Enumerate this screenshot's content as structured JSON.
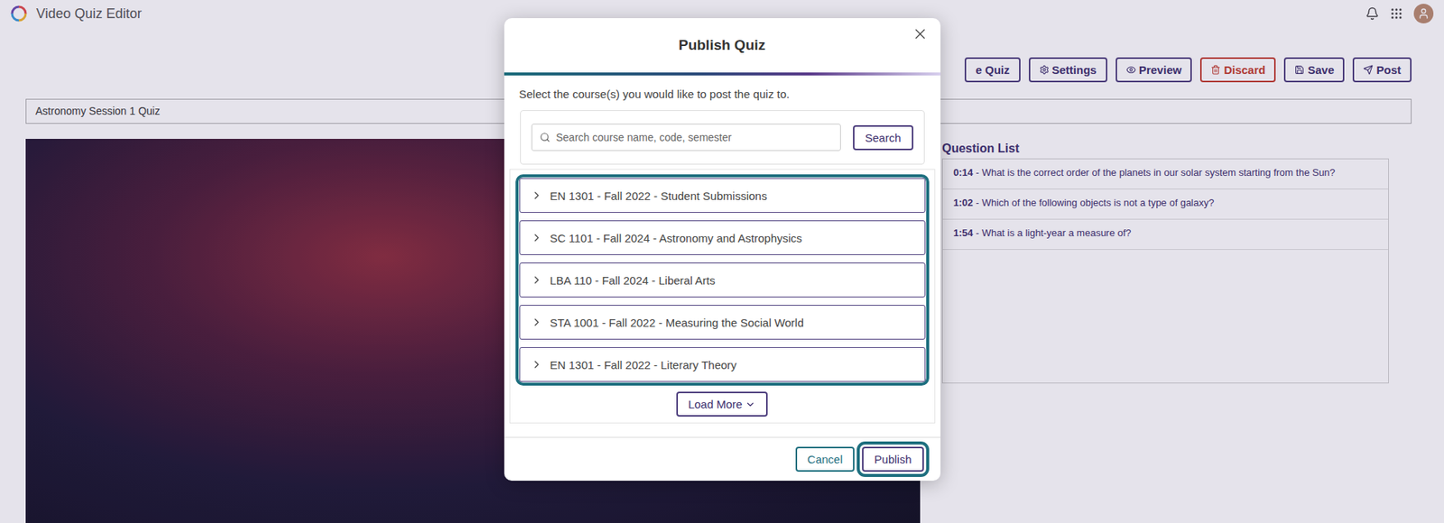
{
  "app": {
    "title": "Video Quiz Editor"
  },
  "toolbar": {
    "buttons": [
      {
        "label": "e Quiz",
        "kind": "normal"
      },
      {
        "label": "Settings",
        "kind": "normal"
      },
      {
        "label": "Preview",
        "kind": "normal"
      },
      {
        "label": "Discard",
        "kind": "danger"
      },
      {
        "label": "Save",
        "kind": "normal"
      },
      {
        "label": "Post",
        "kind": "normal"
      }
    ]
  },
  "quiz_title": "Astronomy Session 1 Quiz",
  "question_list": {
    "title": "Question List",
    "separator": "-",
    "items": [
      {
        "time": "0:14",
        "text": "What is the correct order of the planets in our solar system starting from the Sun?"
      },
      {
        "time": "1:02",
        "text": "Which of the following objects is not a type of galaxy?"
      },
      {
        "time": "1:54",
        "text": "What is a light-year a measure of?"
      }
    ]
  },
  "dialog": {
    "title": "Publish Quiz",
    "instruction": "Select the course(s) you would like to post the quiz to.",
    "search": {
      "placeholder": "Search course name, code, semester",
      "button": "Search"
    },
    "courses": [
      {
        "label": "EN 1301 - Fall 2022 - Student Submissions",
        "expanded": false
      },
      {
        "label": "SC 1101 - Fall 2024 - Astronomy and Astrophysics",
        "expanded": false
      },
      {
        "label": "LBA 110 - Fall 2024 - Liberal Arts",
        "expanded": false
      },
      {
        "label": "STA 1001 - Fall 2022 - Measuring the Social World",
        "expanded": false
      },
      {
        "label": "EN 1301 - Fall 2022 - Literary Theory",
        "expanded": false
      }
    ],
    "load_more": "Load More",
    "buttons": [
      {
        "label": "Cancel",
        "highlighted": false
      },
      {
        "label": "Publish",
        "highlighted": true
      }
    ]
  }
}
